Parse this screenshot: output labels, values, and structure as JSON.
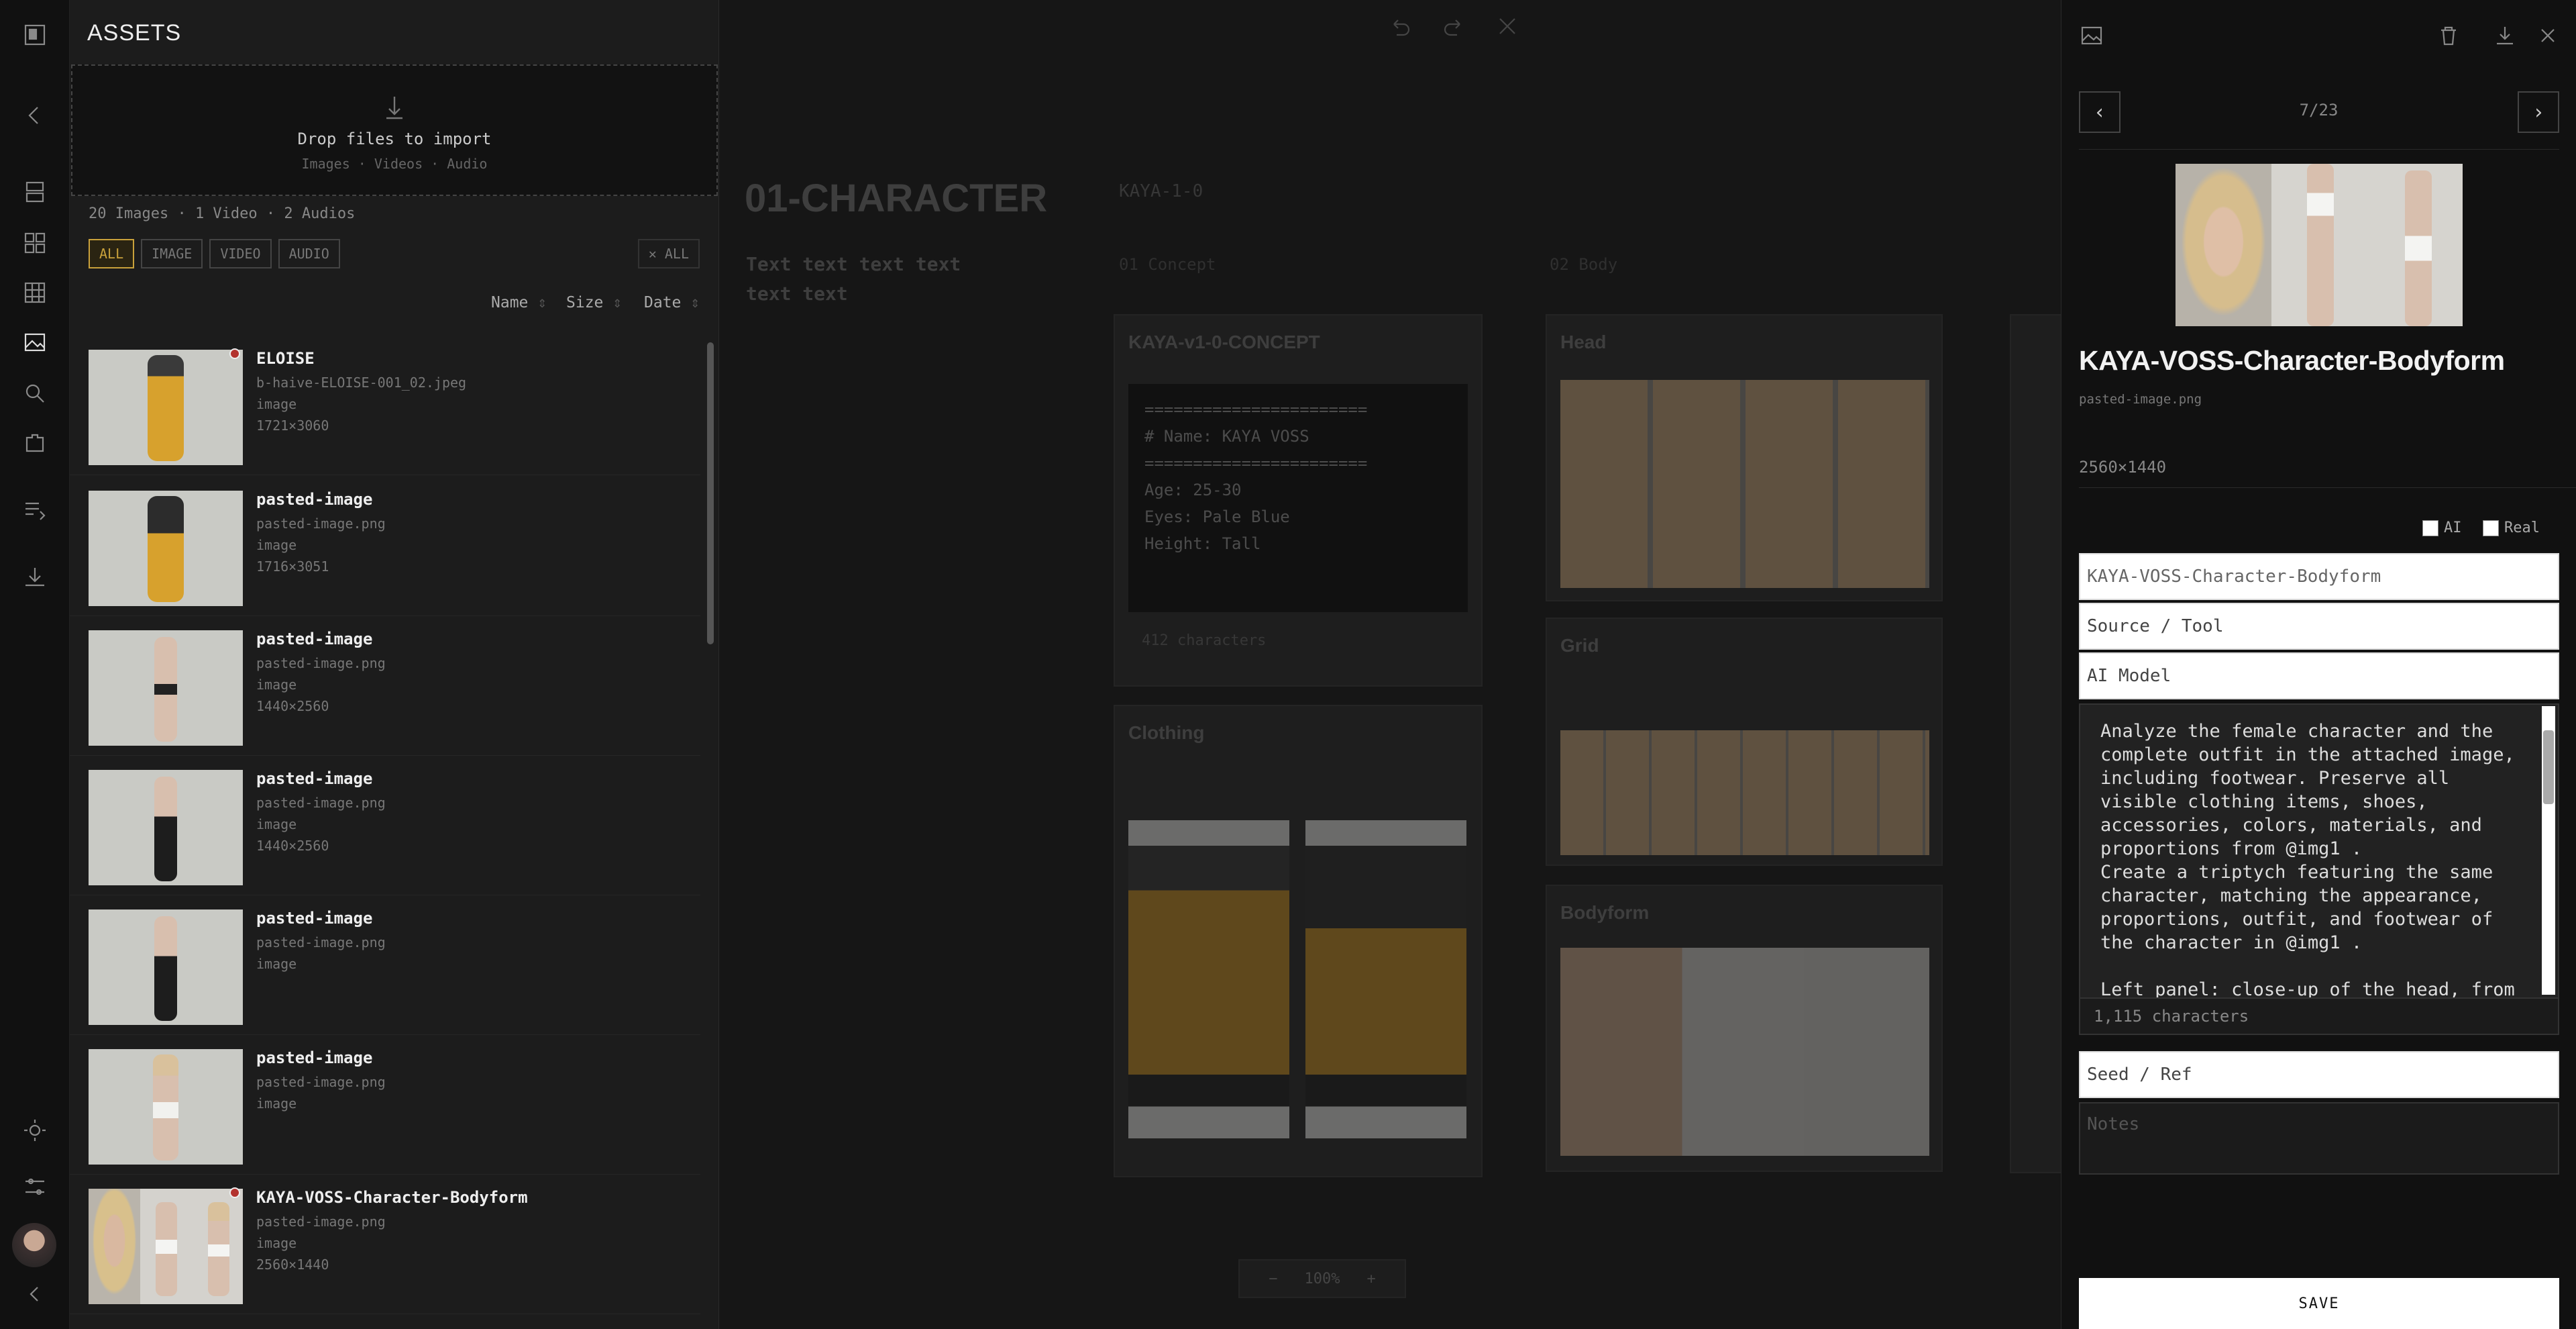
{
  "assets": {
    "title": "ASSETS",
    "drop": {
      "title": "Drop files to import",
      "types": "Images · Videos · Audio"
    },
    "counts": "20 Images · 1 Video · 2 Audios",
    "filters": [
      {
        "label": "ALL"
      },
      {
        "label": "IMAGE"
      },
      {
        "label": "VIDEO"
      },
      {
        "label": "AUDIO"
      }
    ],
    "clear_all": "✕ ALL",
    "sort": {
      "name": "Name",
      "size": "Size",
      "date": "Date"
    },
    "items": [
      {
        "name": "ELOISE",
        "file": "b-haive-ELOISE-001_02.jpeg",
        "type": "image",
        "dims": "1721×3060"
      },
      {
        "name": "pasted-image",
        "file": "pasted-image.png",
        "type": "image",
        "dims": "1716×3051"
      },
      {
        "name": "pasted-image",
        "file": "pasted-image.png",
        "type": "image",
        "dims": "1440×2560"
      },
      {
        "name": "pasted-image",
        "file": "pasted-image.png",
        "type": "image",
        "dims": "1440×2560"
      },
      {
        "name": "pasted-image",
        "file": "pasted-image.png",
        "type": "image",
        "dims": ""
      },
      {
        "name": "pasted-image",
        "file": "pasted-image.png",
        "type": "image",
        "dims": ""
      },
      {
        "name": "KAYA-VOSS-Character-Bodyform",
        "file": "pasted-image.png",
        "type": "image",
        "dims": "2560×1440"
      }
    ]
  },
  "canvas": {
    "heading": "01-CHARACTER",
    "subtext": "Text text text text text text",
    "column_label": "KAYA-1-0",
    "col_concept": "01 Concept",
    "col_body": "02 Body",
    "concept_card": "KAYA-v1-0-CONCEPT",
    "concept_text": [
      "=======================",
      "# Name: KAYA VOSS",
      "=======================",
      "Age: 25-30",
      "Eyes: Pale Blue",
      "Height: Tall"
    ],
    "concept_count": "412 characters",
    "clothing": "Clothing",
    "head": "Head",
    "grid": "Grid",
    "bodyform": "Bodyform",
    "zoom": "100%"
  },
  "detail": {
    "counter": "7/23",
    "title": "KAYA-VOSS-Character-Bodyform",
    "filename": "pasted-image.png",
    "dims": "2560×1440",
    "ai_label": "AI",
    "real_label": "Real",
    "name_value": "KAYA-VOSS-Character-Bodyform",
    "source_placeholder": "Source / Tool",
    "model_placeholder": "AI Model",
    "prompt": "Analyze the female character and the complete outfit in the attached image, including footwear. Preserve all visible clothing items, shoes, accessories, colors, materials, and proportions from @img1 .\nCreate a triptych featuring the same character, matching the appearance, proportions, outfit, and footwear of the character in @img1 .\n\nLeft panel: close-up of the head, from",
    "char_count": "1,115 characters",
    "seed_placeholder": "Seed / Ref",
    "notes_placeholder": "Notes",
    "save": "SAVE"
  }
}
